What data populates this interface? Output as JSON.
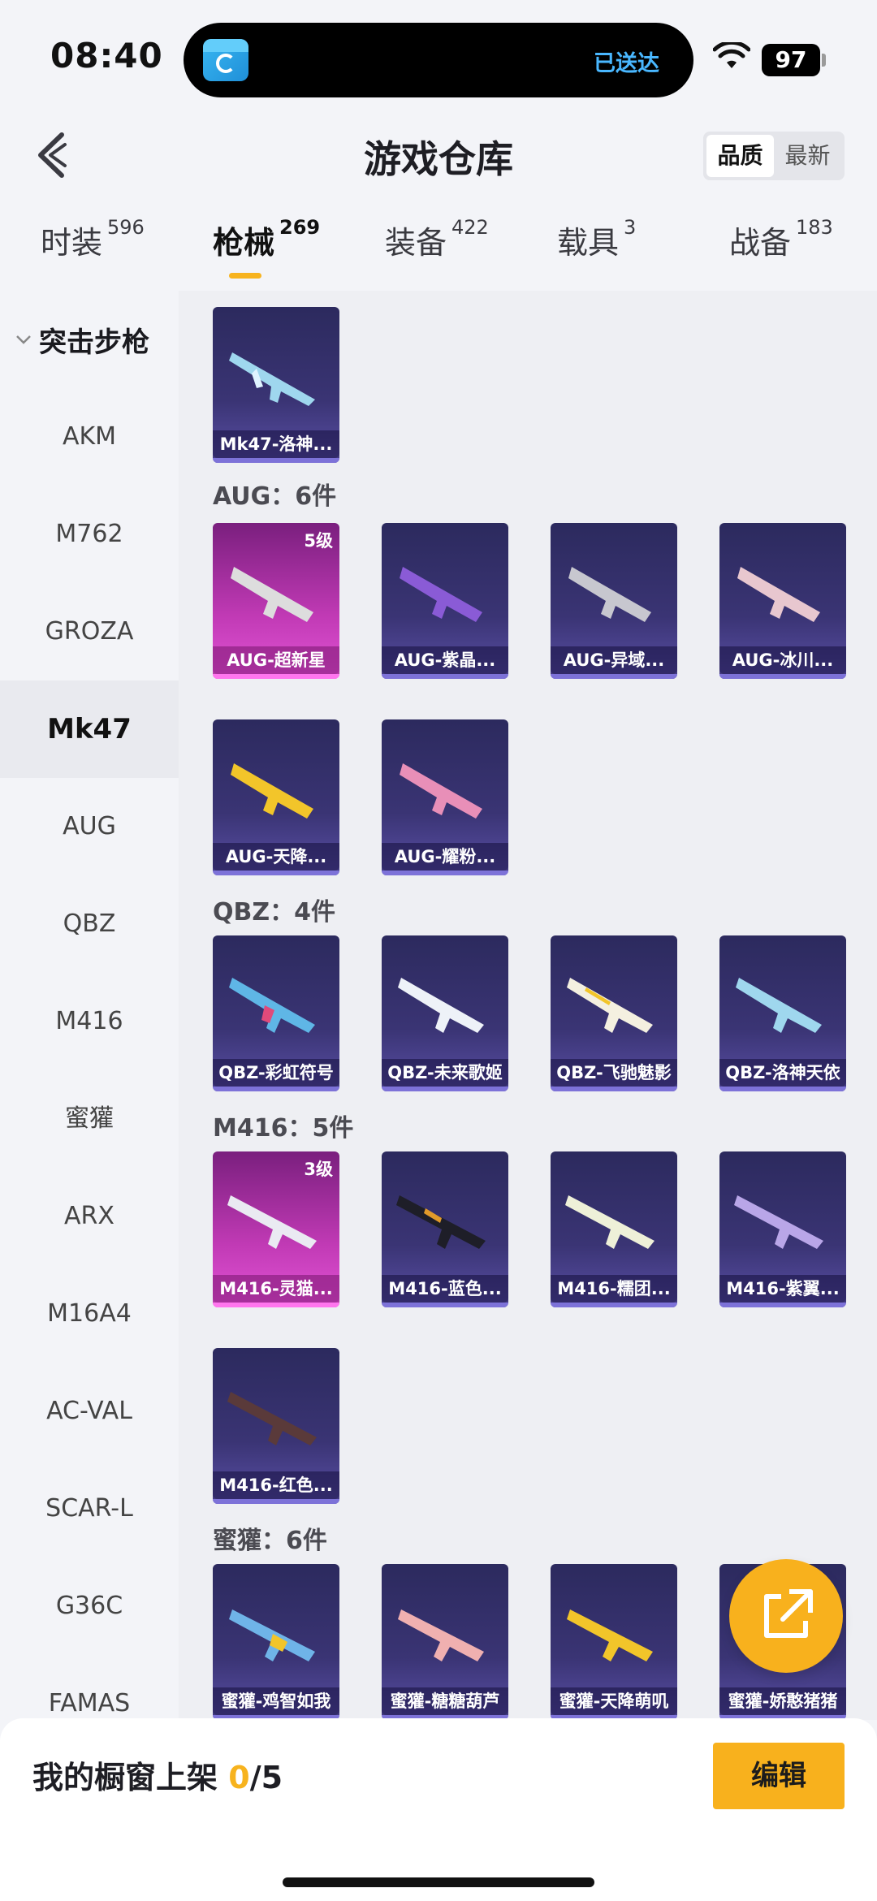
{
  "status": {
    "time": "08:40",
    "notice": "已送达",
    "battery": "97"
  },
  "header": {
    "title": "游戏仓库",
    "sort": {
      "quality": "品质",
      "newest": "最新"
    }
  },
  "tabs": [
    {
      "label": "时装",
      "count": "596"
    },
    {
      "label": "枪械",
      "count": "269"
    },
    {
      "label": "装备",
      "count": "422"
    },
    {
      "label": "载具",
      "count": "3"
    },
    {
      "label": "战备",
      "count": "183"
    }
  ],
  "sidebar": {
    "group": "突击步枪",
    "items": [
      "AKM",
      "M762",
      "GROZA",
      "Mk47",
      "AUG",
      "QBZ",
      "M416",
      "蜜獾",
      "ARX",
      "M16A4",
      "AC-VAL",
      "SCAR-L",
      "G36C",
      "FAMAS"
    ]
  },
  "sections": {
    "mk47": {
      "items": [
        "Mk47-洛神..."
      ]
    },
    "aug": {
      "title": "AUG：6件",
      "items": [
        "AUG-超新星",
        "AUG-紫晶...",
        "AUG-异域...",
        "AUG-冰川...",
        "AUG-天降...",
        "AUG-耀粉..."
      ],
      "level": "5级"
    },
    "qbz": {
      "title": "QBZ：4件",
      "items": [
        "QBZ-彩虹符号",
        "QBZ-未来歌姬",
        "QBZ-飞驰魅影",
        "QBZ-洛神天依"
      ]
    },
    "m416": {
      "title": "M416：5件",
      "items": [
        "M416-灵猫...",
        "M416-蓝色...",
        "M416-糯团...",
        "M416-紫翼...",
        "M416-红色..."
      ],
      "level": "3级"
    },
    "honeybadger": {
      "title": "蜜獾：6件",
      "items": [
        "蜜獾-鸡智如我",
        "蜜獾-糖糖葫芦",
        "蜜獾-天降萌叽",
        "蜜獾-娇憨猪猪"
      ]
    }
  },
  "bottom": {
    "label": "我的橱窗上架",
    "count": "0",
    "total": "/5",
    "edit": "编辑"
  },
  "colors": {
    "accent": "#f8b11d",
    "card": "#3a3474",
    "card_pink": "#c13ab5"
  }
}
